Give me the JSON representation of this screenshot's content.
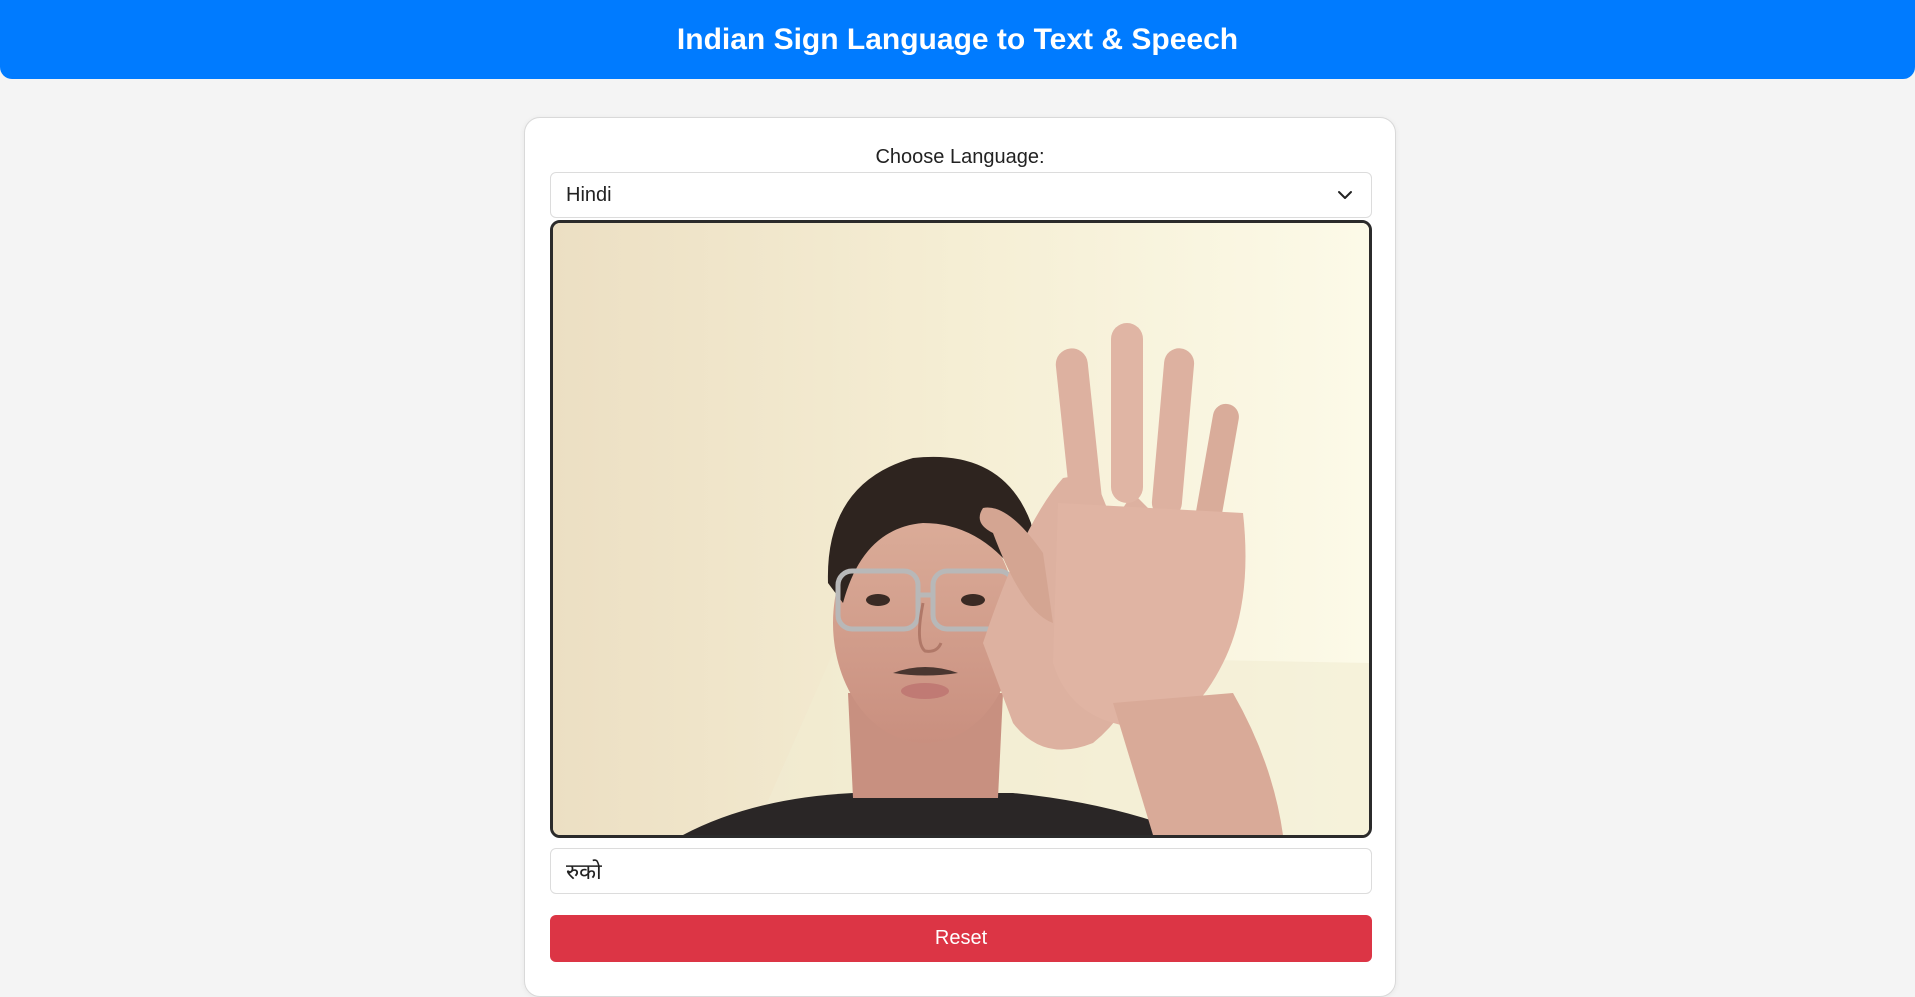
{
  "header": {
    "title": "Indian Sign Language to Text & Speech",
    "color": "#007bff"
  },
  "language": {
    "label": "Choose Language:",
    "selected": "Hindi"
  },
  "camera": {
    "icon": "webcam-feed"
  },
  "output": {
    "text": "रुको"
  },
  "actions": {
    "reset_label": "Reset",
    "reset_color": "#dc3545"
  }
}
